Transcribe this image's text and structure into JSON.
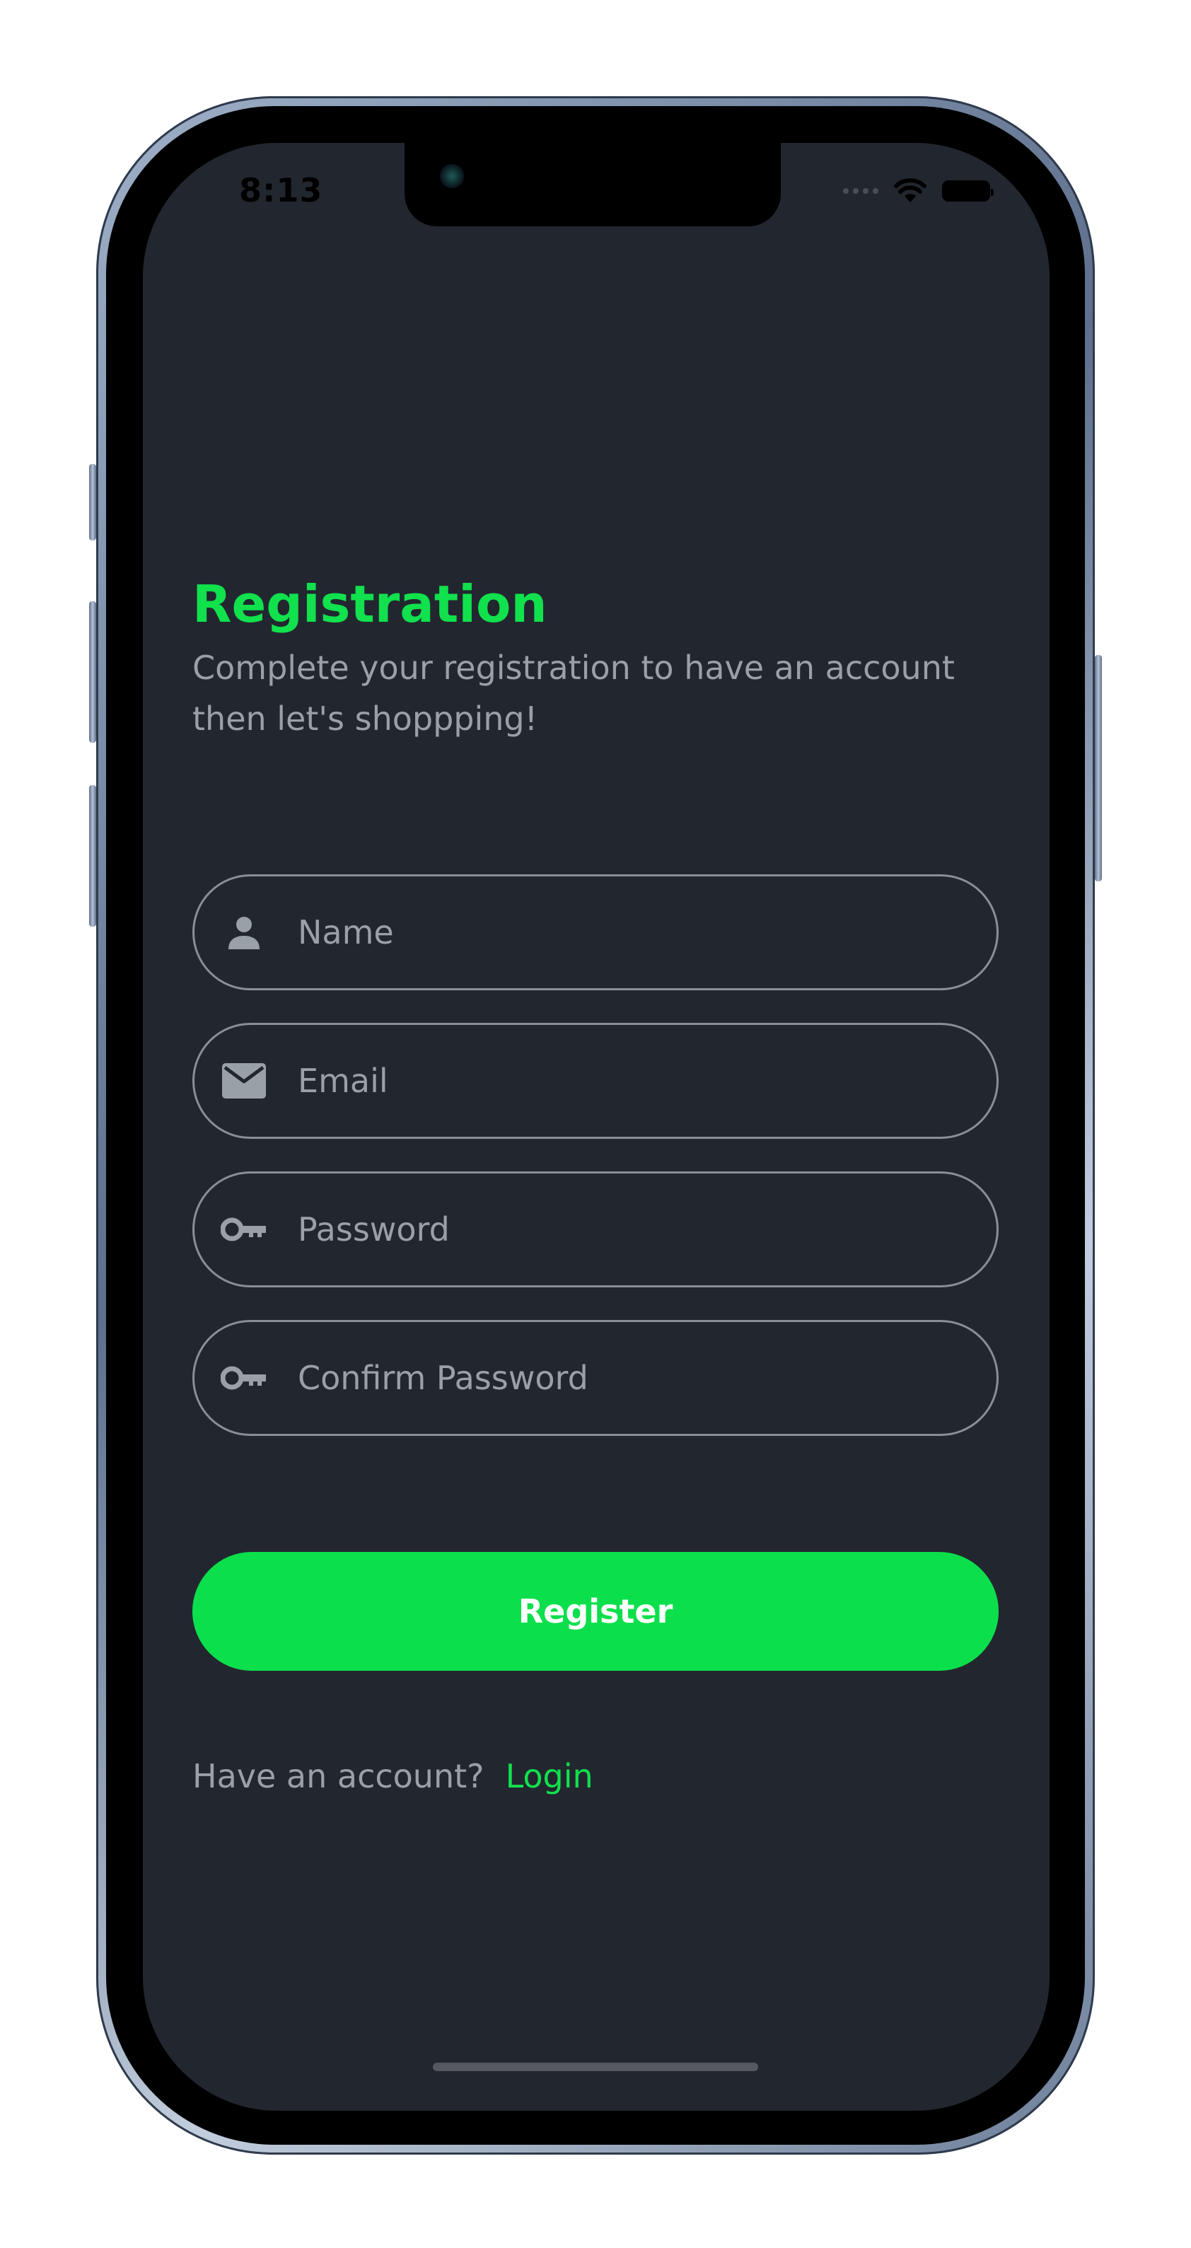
{
  "status_bar": {
    "time": "8:13"
  },
  "register_page": {
    "title": "Registration",
    "subtitle": "Complete your registration to have an account then let's shoppping!",
    "fields": [
      {
        "placeholder": "Name",
        "icon": "person-icon"
      },
      {
        "placeholder": "Email",
        "icon": "envelope-icon"
      },
      {
        "placeholder": "Password",
        "icon": "key-icon"
      },
      {
        "placeholder": "Confirm Password",
        "icon": "key-icon"
      }
    ],
    "register_label": "Register",
    "have_account_text": "Have an account?",
    "login_label": "Login"
  },
  "colors": {
    "accent": "#10e14d",
    "background": "#22272f",
    "muted_text": "#9aa0a8",
    "field_border": "#8a8f97"
  }
}
